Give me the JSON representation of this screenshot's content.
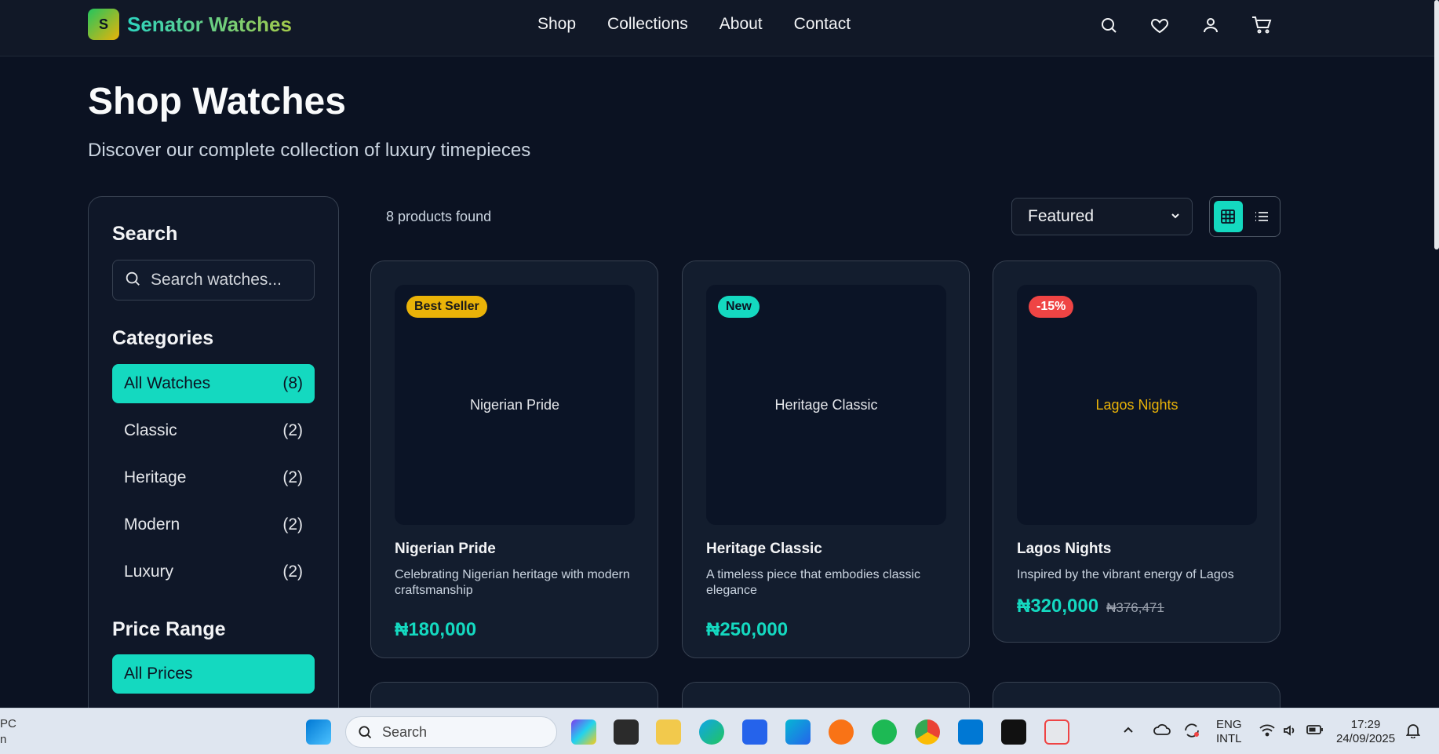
{
  "brand": {
    "initial": "S",
    "name": "Senator Watches"
  },
  "nav": [
    "Shop",
    "Collections",
    "About",
    "Contact"
  ],
  "header_icons": [
    "search-icon",
    "heart-icon",
    "user-icon",
    "cart-icon"
  ],
  "page": {
    "title": "Shop Watches",
    "subtitle": "Discover our complete collection of luxury timepieces"
  },
  "sidebar": {
    "search_title": "Search",
    "search_placeholder": "Search watches...",
    "categories_title": "Categories",
    "categories": [
      {
        "label": "All Watches",
        "count": "(8)",
        "active": true
      },
      {
        "label": "Classic",
        "count": "(2)"
      },
      {
        "label": "Heritage",
        "count": "(2)"
      },
      {
        "label": "Modern",
        "count": "(2)"
      },
      {
        "label": "Luxury",
        "count": "(2)"
      }
    ],
    "price_title": "Price Range",
    "price_selected": "All Prices"
  },
  "toolbar": {
    "count": "8 products found",
    "sort": "Featured"
  },
  "products": [
    {
      "badge": "Best Seller",
      "badge_bg": "#eab308",
      "image_label": "Nigerian Pride",
      "image_color": "#e5e7eb",
      "name": "Nigerian Pride",
      "desc": "Celebrating Nigerian heritage with modern craftsmanship",
      "price": "₦180,000",
      "old_price": ""
    },
    {
      "badge": "New",
      "badge_bg": "#14d9c0",
      "image_label": "Heritage Classic",
      "image_color": "#e5e7eb",
      "name": "Heritage Classic",
      "desc": "A timeless piece that embodies classic elegance",
      "price": "₦250,000",
      "old_price": ""
    },
    {
      "badge": "-15%",
      "badge_bg": "#ef4444",
      "image_label": "Lagos Nights",
      "image_color": "#eab308",
      "name": "Lagos Nights",
      "desc": "Inspired by the vibrant energy of Lagos",
      "price": "₦320,000",
      "old_price": "₦376,471"
    }
  ],
  "taskbar": {
    "left_line1": "PC",
    "left_line2": "n",
    "search": "Search",
    "lang1": "ENG",
    "lang2": "INTL",
    "time": "17:29",
    "date": "24/09/2025"
  },
  "colors": {
    "accent": "#14d9c0",
    "background": "#0b1222"
  }
}
